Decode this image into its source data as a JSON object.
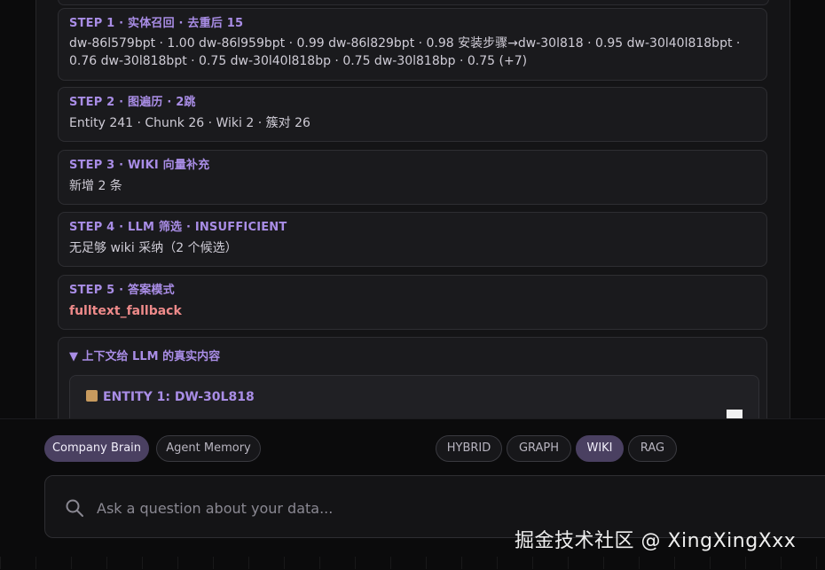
{
  "steps": [
    {
      "title": "STEP 1 · 实体召回 · 去重后 15",
      "body": "dw-86l579bpt · 1.00    dw-86l959bpt · 0.99    dw-86l829bpt · 0.98    安装步骤→dw-30l818 · 0.95    dw-30l40l818bpt · 0.76    dw-30l818bpt · 0.75    dw-30l40l818bp · 0.75    dw-30l818bp · 0.75    (+7)",
      "tone": "normal"
    },
    {
      "title": "STEP 2 · 图遍历 · 2跳",
      "body": "Entity 241 · Chunk 26 · Wiki 2 · 簇对 26",
      "tone": "normal"
    },
    {
      "title": "STEP 3 · WIKI 向量补充",
      "body": "新增 2 条",
      "tone": "normal"
    },
    {
      "title": "STEP 4 · LLM 筛选 · INSUFFICIENT",
      "body": "无足够 wiki 采纳（2 个候选）",
      "tone": "normal"
    },
    {
      "title": "STEP 5 · 答案模式",
      "body": "fulltext_fallback",
      "tone": "warn"
    }
  ],
  "context": {
    "title": "▼ 上下文给 LLM 的真实内容",
    "entity_title": "ENTITY 1: DW-30L818",
    "entity_icon": "package-icon"
  },
  "source_tabs": [
    {
      "label": "Company Brain",
      "active": true
    },
    {
      "label": "Agent Memory",
      "active": false
    }
  ],
  "mode_tabs": [
    {
      "label": "HYBRID",
      "active": false
    },
    {
      "label": "GRAPH",
      "active": false
    },
    {
      "label": "WIKI",
      "active": true
    },
    {
      "label": "RAG",
      "active": false
    }
  ],
  "search": {
    "placeholder": "Ask a question about your data..."
  },
  "watermark": "掘金技术社区 @ XingXingXxx"
}
